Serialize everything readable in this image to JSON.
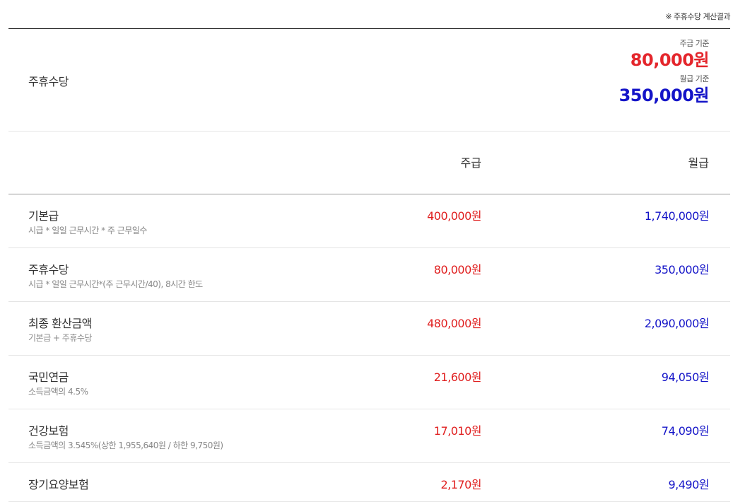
{
  "note": "※ 주휴수당 계산결과",
  "summary": {
    "label": "주휴수당",
    "weekly_caption": "주급 기준",
    "weekly_amount": "80,000원",
    "monthly_caption": "월급 기준",
    "monthly_amount": "350,000원"
  },
  "columns": {
    "weekly": "주급",
    "monthly": "월급"
  },
  "rows": [
    {
      "label": "기본급",
      "desc": "시급 * 일일 근무시간 * 주 근무일수",
      "weekly": "400,000원",
      "monthly": "1,740,000원"
    },
    {
      "label": "주휴수당",
      "desc": "시급 * 일일 근무시간*(주 근무시간/40), 8시간 한도",
      "weekly": "80,000원",
      "monthly": "350,000원"
    },
    {
      "label": "최종 환산금액",
      "desc": "기본급 + 주휴수당",
      "weekly": "480,000원",
      "monthly": "2,090,000원"
    },
    {
      "label": "국민연금",
      "desc": "소득금액의 4.5%",
      "weekly": "21,600원",
      "monthly": "94,050원"
    },
    {
      "label": "건강보험",
      "desc": "소득금액의 3.545%(상한 1,955,640원 / 하한 9,750원)",
      "weekly": "17,010원",
      "monthly": "74,090원"
    },
    {
      "label": "장기요양보험",
      "desc": "",
      "weekly": "2,170원",
      "monthly": "9,490원"
    }
  ],
  "colors": {
    "weekly": "#e02020",
    "monthly": "#1414c8"
  }
}
